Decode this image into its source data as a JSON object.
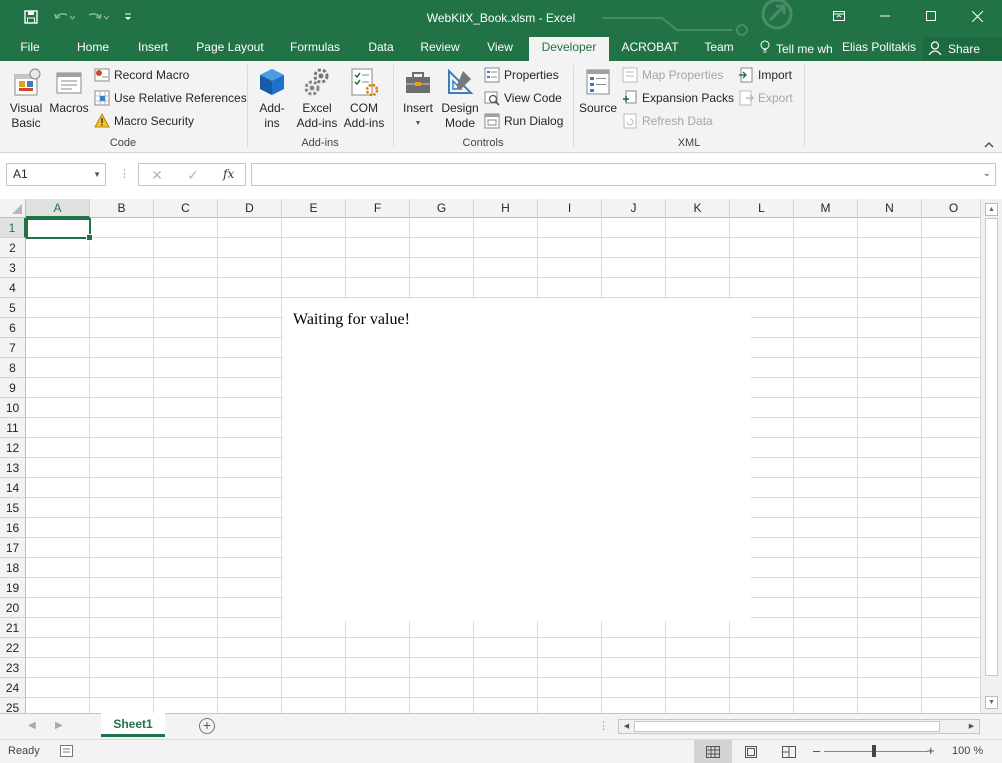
{
  "titlebar": {
    "title": "WebKitX_Book.xlsm - Excel",
    "accent": "#217346"
  },
  "tabs": [
    {
      "label": "File"
    },
    {
      "label": "Home"
    },
    {
      "label": "Insert"
    },
    {
      "label": "Page Layout"
    },
    {
      "label": "Formulas"
    },
    {
      "label": "Data"
    },
    {
      "label": "Review"
    },
    {
      "label": "View"
    },
    {
      "label": "Developer",
      "active": true
    },
    {
      "label": "ACROBAT"
    },
    {
      "label": "Team"
    }
  ],
  "tellme": "Tell me wh",
  "user": "Elias Politakis",
  "share": "Share",
  "ribbon": {
    "code": {
      "label": "Code",
      "visual_basic": [
        "Visual",
        "Basic"
      ],
      "macros": "Macros",
      "record_macro": "Record Macro",
      "relative_refs": "Use Relative References",
      "macro_security": "Macro Security"
    },
    "addins": {
      "label": "Add-ins",
      "addins_btn": [
        "Add-",
        "ins"
      ],
      "excel_addins": [
        "Excel",
        "Add-ins"
      ],
      "com_addins": [
        "COM",
        "Add-ins"
      ]
    },
    "controls": {
      "label": "Controls",
      "insert": "Insert",
      "design_mode": [
        "Design",
        "Mode"
      ],
      "properties": "Properties",
      "view_code": "View Code",
      "run_dialog": "Run Dialog"
    },
    "xml": {
      "label": "XML",
      "source": "Source",
      "map_properties": "Map Properties",
      "expansion_packs": "Expansion Packs",
      "refresh_data": "Refresh Data",
      "import": "Import",
      "export": "Export"
    }
  },
  "formula": {
    "namebox": "A1",
    "fx": "fx",
    "value": ""
  },
  "grid": {
    "columns": [
      "A",
      "B",
      "C",
      "D",
      "E",
      "F",
      "G",
      "H",
      "I",
      "J",
      "K",
      "L",
      "M",
      "N",
      "O"
    ],
    "rows": [
      "1",
      "2",
      "3",
      "4",
      "5",
      "6",
      "7",
      "8",
      "9",
      "10",
      "11",
      "12",
      "13",
      "14",
      "15",
      "16",
      "17",
      "18",
      "19",
      "20",
      "21",
      "22",
      "23",
      "24",
      "25"
    ],
    "active_cell": "A1"
  },
  "webview": {
    "message": "Waiting for value!"
  },
  "sheets": [
    {
      "name": "Sheet1",
      "active": true
    }
  ],
  "status": {
    "ready": "Ready",
    "zoom": "100 %"
  }
}
